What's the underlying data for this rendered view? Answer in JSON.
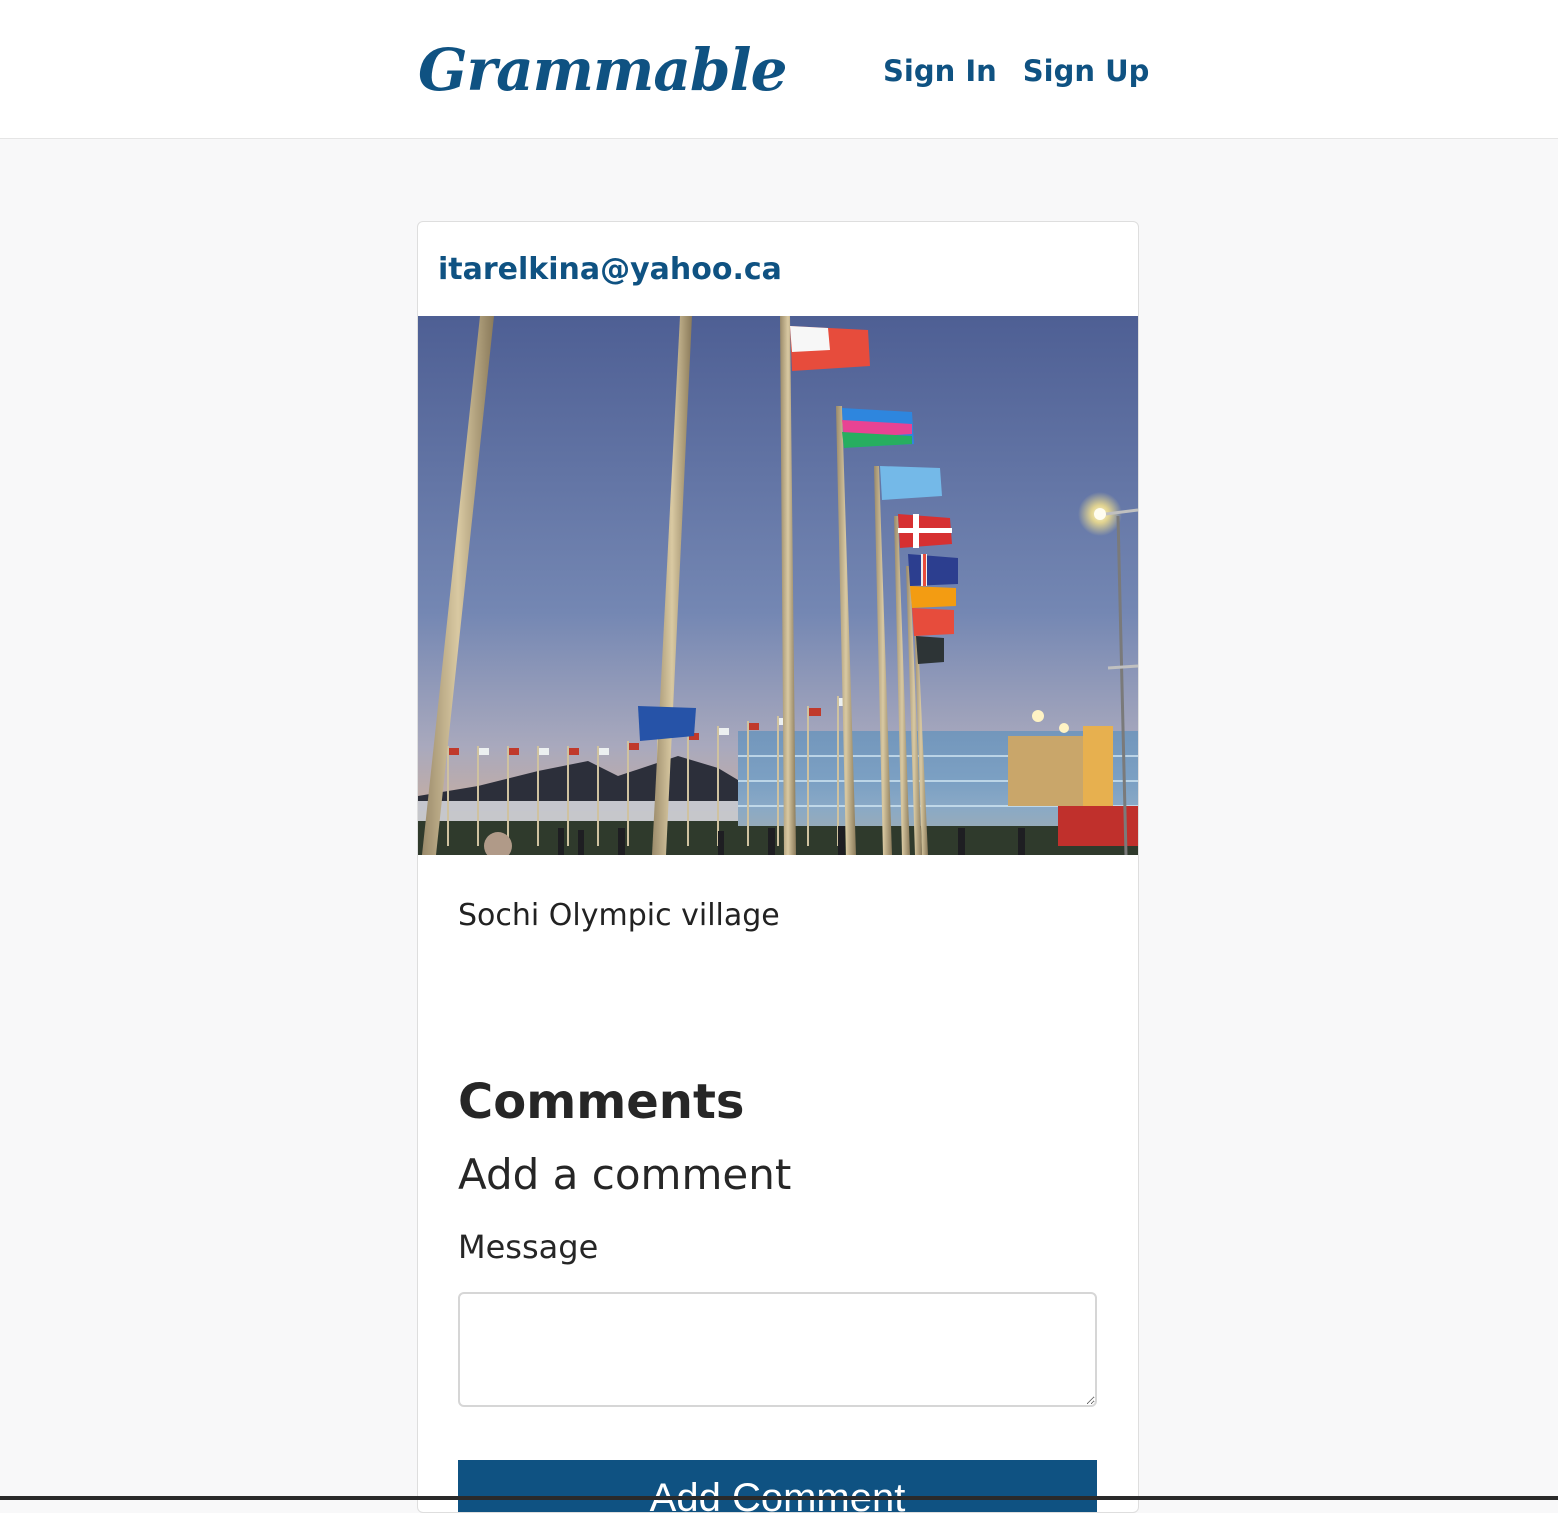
{
  "brand": "Grammable",
  "nav": {
    "sign_in": "Sign In",
    "sign_up": "Sign Up"
  },
  "post": {
    "author": "itarelkina@yahoo.ca",
    "caption": "Sochi Olympic village"
  },
  "comments": {
    "heading": "Comments",
    "add_heading": "Add a comment",
    "message_label": "Message",
    "message_value": "",
    "submit_label": "Add Comment"
  },
  "colors": {
    "brand": "#0f5282",
    "page_background": "#f8f8f9",
    "card_background": "#ffffff"
  }
}
